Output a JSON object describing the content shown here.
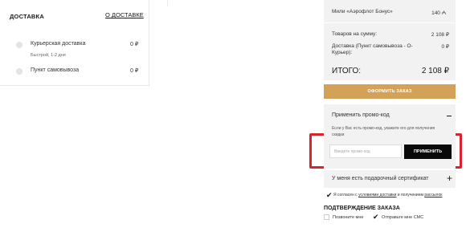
{
  "delivery": {
    "title": "ДОСТАВКА",
    "about_link": "О ДОСТАВКЕ",
    "options": [
      {
        "name": "Курьерская доставка",
        "sub": "Быстрой, 1-2 дня",
        "price": "0 ₽",
        "selected": false
      },
      {
        "name": "Пункт самовывоза",
        "sub": "",
        "price": "0 ₽",
        "selected": false
      }
    ]
  },
  "summary": {
    "miles": {
      "label": "Мили «Аэрофлот Бонус»",
      "value": "140 ₼"
    },
    "rows": [
      {
        "label": "Товаров на сумму:",
        "value": "2 108 ₽"
      },
      {
        "label": "Доставка (Пункт самовывоза - О-Курьер):",
        "value": "0 ₽"
      }
    ],
    "total": {
      "label": "ИТОГО:",
      "value": "2 108 ₽"
    },
    "order_button": "ОФОРМИТЬ ЗАКАЗ"
  },
  "promo": {
    "header": "Применить промо-код",
    "hint": "Если у Вас есть промо-код, укажите его для получения скидки",
    "input_placeholder": "Введите промо-код",
    "input_value": "",
    "apply_button": "ПРИМЕНИТЬ"
  },
  "certificate": {
    "label": "У меня есть подарочный сертификат"
  },
  "agreement": {
    "prefix": "Я согласен с ",
    "link1": "условиями доставки",
    "middle": " и получением ",
    "link2": "рассылок",
    "checked": true
  },
  "confirmation": {
    "title": "ПОДТВЕРЖДЕНИЕ ЗАКАЗА",
    "options": [
      {
        "label": "Позвоните мне",
        "checked": false
      },
      {
        "label": "Отправьте мне СМС",
        "checked": true
      }
    ]
  },
  "colors": {
    "accent": "#d4a159",
    "panel": "#f2f2f2",
    "highlight": "#d9232e",
    "button_dark": "#0a0a0a"
  }
}
